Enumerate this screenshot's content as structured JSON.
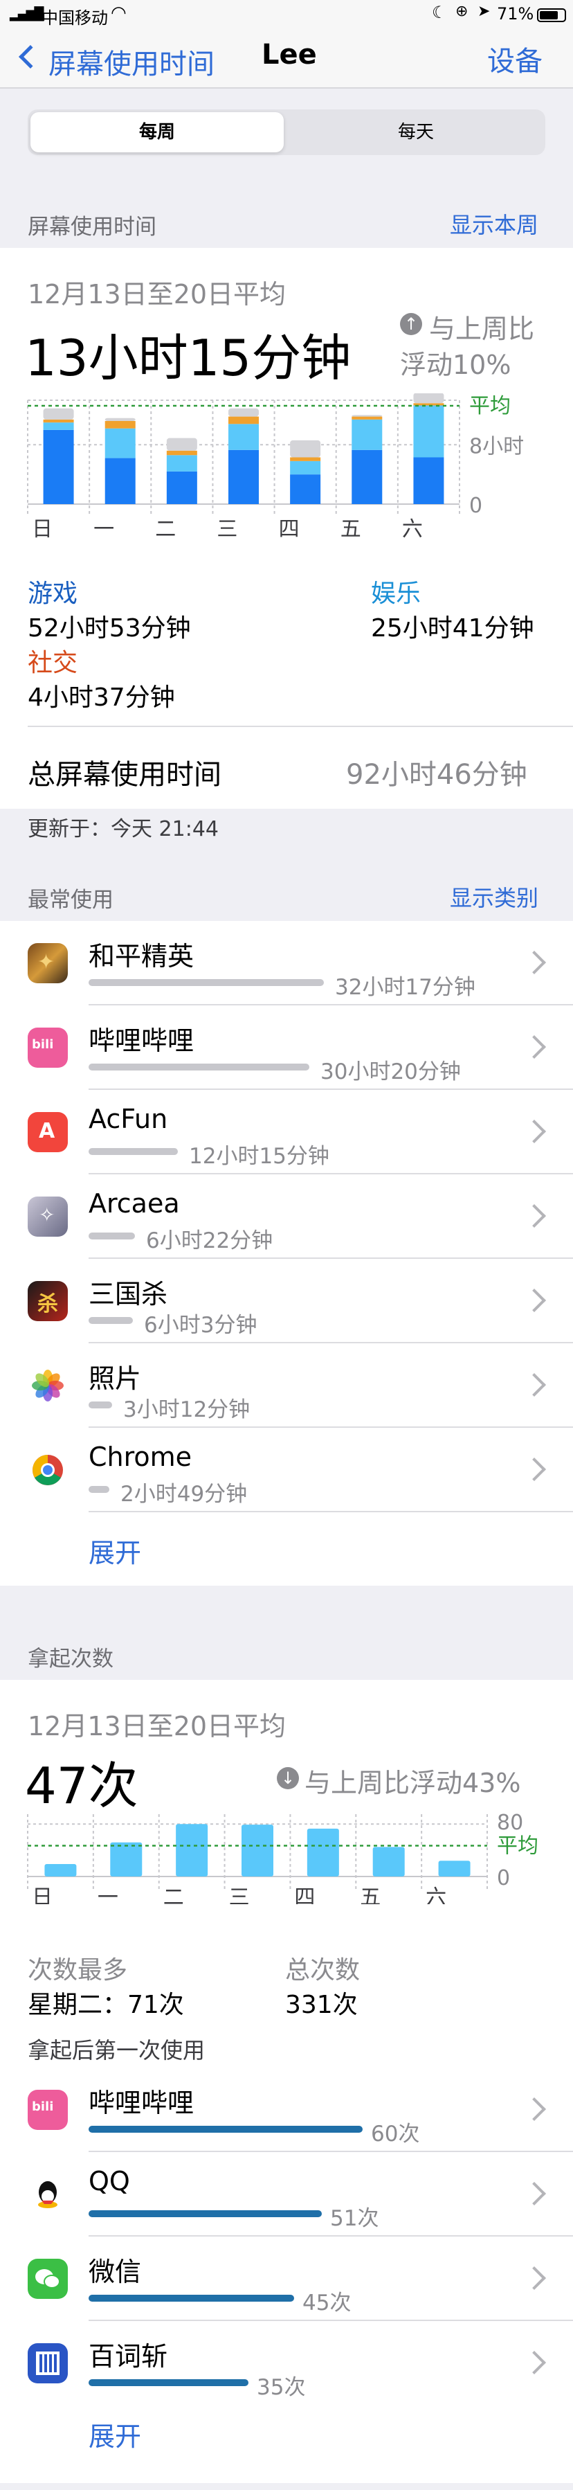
{
  "status_bar": {
    "carrier": "中国移动",
    "battery": "71%"
  },
  "nav": {
    "back_label": "屏幕使用时间",
    "title": "Lee",
    "right_label": "设备"
  },
  "segmented": {
    "weekly": "每周",
    "daily": "每天",
    "selected": "每周"
  },
  "screen_time": {
    "section_header": "屏幕使用时间",
    "section_action": "显示本周",
    "period": "12月13日至20日平均",
    "average": "13小时15分钟",
    "compare_line1": "与上周比",
    "compare_line2": "浮动10%",
    "avg_label": "平均",
    "y_label_mid": "8小时",
    "y_label_zero": "0",
    "days": [
      "日",
      "一",
      "二",
      "三",
      "四",
      "五",
      "六"
    ],
    "categories": [
      {
        "name": "游戏",
        "time": "52小时53分钟",
        "color": "#1a7cf5"
      },
      {
        "name": "娱乐",
        "time": "25小时41分钟",
        "color": "#5ac8fa"
      },
      {
        "name": "社交",
        "time": "4小时37分钟",
        "color": "#f0a12e"
      }
    ],
    "total_label": "总屏幕使用时间",
    "total_value": "92小时46分钟",
    "updated": "更新于：今天 21:44"
  },
  "chart_data": [
    {
      "type": "bar",
      "title": "",
      "categories": [
        "日",
        "一",
        "二",
        "三",
        "四",
        "五",
        "六"
      ],
      "series": [
        {
          "name": "游戏",
          "values": [
            10.0,
            6.2,
            4.4,
            7.3,
            4.0,
            7.3,
            6.3
          ]
        },
        {
          "name": "娱乐",
          "values": [
            1.0,
            4.0,
            2.2,
            3.5,
            1.8,
            4.1,
            7.0
          ]
        },
        {
          "name": "社交",
          "values": [
            0.4,
            1.0,
            0.6,
            1.0,
            0.5,
            0.4,
            0.3
          ]
        },
        {
          "name": "",
          "values": [
            1.5,
            0.4,
            1.7,
            1.1,
            2.3,
            0.2,
            1.4
          ]
        }
      ],
      "average": 13.25,
      "ylim": [
        0,
        14
      ],
      "yticks": [
        "8小时",
        "0"
      ],
      "colors": [
        "#1a7cf5",
        "#5ac8fa",
        "#f0a12e",
        "#d4d4d8"
      ]
    },
    {
      "type": "bar",
      "title": "",
      "categories": [
        "日",
        "一",
        "二",
        "三",
        "四",
        "五",
        "六"
      ],
      "values": [
        19,
        52,
        80,
        79,
        73,
        45,
        24
      ],
      "average": 47,
      "ylim": [
        0,
        95
      ],
      "yticks": [
        "80",
        "0"
      ],
      "colors": [
        "#5ac8fa"
      ]
    }
  ],
  "most_used": {
    "section_header": "最常使用",
    "section_action": "显示类别",
    "apps": [
      {
        "name": "和平精英",
        "time": "32小时17分钟",
        "minutes": 1937,
        "icon": "game-icon"
      },
      {
        "name": "哔哩哔哩",
        "time": "30小时20分钟",
        "minutes": 1820,
        "icon": "bilibili-icon"
      },
      {
        "name": "AcFun",
        "time": "12小时15分钟",
        "minutes": 735,
        "icon": "acfun-icon"
      },
      {
        "name": "Arcaea",
        "time": "6小时22分钟",
        "minutes": 382,
        "icon": "arcaea-icon"
      },
      {
        "name": "三国杀",
        "time": "6小时3分钟",
        "minutes": 363,
        "icon": "sanguosha-icon"
      },
      {
        "name": "照片",
        "time": "3小时12分钟",
        "minutes": 192,
        "icon": "photos-icon"
      },
      {
        "name": "Chrome",
        "time": "2小时49分钟",
        "minutes": 169,
        "icon": "chrome-icon"
      }
    ],
    "expand": "展开"
  },
  "pickups": {
    "section_header": "拿起次数",
    "period": "12月13日至20日平均",
    "average": "47次",
    "compare": "与上周比浮动43%",
    "avg_label": "平均",
    "y_top": "80",
    "y_zero": "0",
    "days": [
      "日",
      "一",
      "二",
      "三",
      "四",
      "五",
      "六"
    ],
    "most_label": "次数最多",
    "most_value": "星期二：71次",
    "total_label": "总次数",
    "total_value": "331次",
    "first_used_header": "拿起后第一次使用",
    "apps": [
      {
        "name": "哔哩哔哩",
        "count": "60次",
        "value": 60,
        "icon": "bilibili-icon"
      },
      {
        "name": "QQ",
        "count": "51次",
        "value": 51,
        "icon": "qq-icon"
      },
      {
        "name": "微信",
        "count": "45次",
        "value": 45,
        "icon": "wechat-icon"
      },
      {
        "name": "百词斩",
        "count": "35次",
        "value": 35,
        "icon": "baicizhan-icon"
      }
    ],
    "expand": "展开"
  }
}
